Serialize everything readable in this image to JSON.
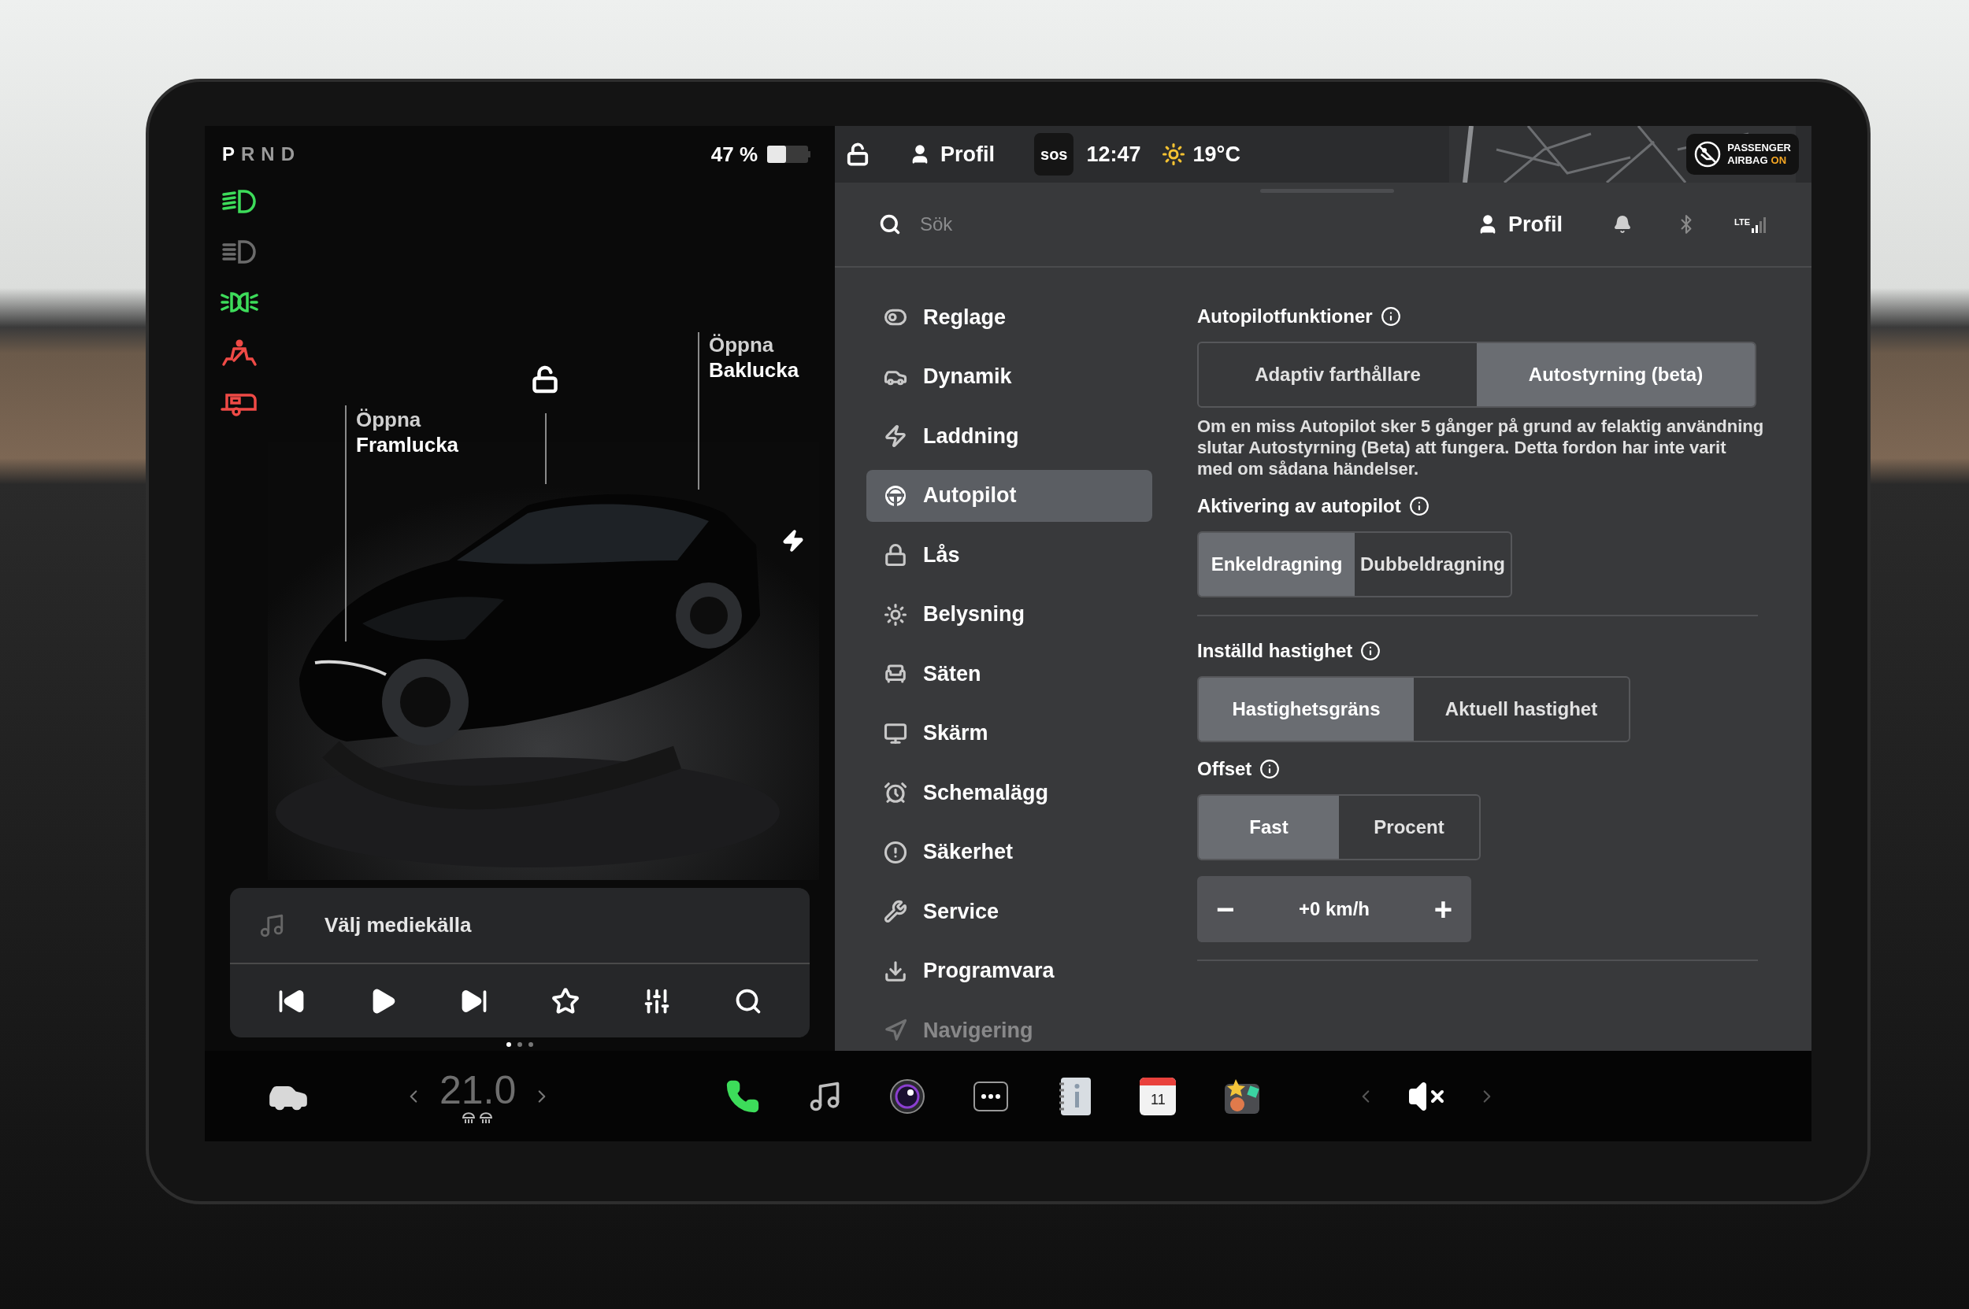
{
  "left_panel": {
    "gears": [
      {
        "label": "P",
        "selected": true
      },
      {
        "label": "R",
        "selected": false
      },
      {
        "label": "N",
        "selected": false
      },
      {
        "label": "D",
        "selected": false
      }
    ],
    "battery": "47 %",
    "indicators": [
      {
        "kind": "headlight",
        "color": "#3ddc5a"
      },
      {
        "kind": "auto_headlight",
        "color": "#6b6b6b"
      },
      {
        "kind": "parking_lights",
        "color": "#3ddc5a"
      },
      {
        "kind": "seatbelt",
        "color": "#ef4a46"
      },
      {
        "kind": "trailer",
        "color": "#ef4a46"
      }
    ],
    "car_labels": [
      {
        "action": "Öppna",
        "target": "Framlucka"
      },
      {
        "action": "Öppna",
        "target": "Baklucka"
      }
    ],
    "media": {
      "source": "Välj mediekälla"
    },
    "pages": [
      {
        "selected": true
      },
      {
        "selected": false
      },
      {
        "selected": false
      }
    ]
  },
  "status_bar": {
    "profile": "Profil",
    "sos": "sos",
    "time": "12:47",
    "temperature": "19°C",
    "airbag": {
      "line1": "PASSENGER",
      "line2": "AIRBAG",
      "state": "ON"
    }
  },
  "settings": {
    "search_placeholder": "Sök",
    "profile": "Profil",
    "network": "LTE",
    "menu": [
      {
        "label": "Reglage",
        "kind": "toggle",
        "selected": false
      },
      {
        "label": "Dynamik",
        "kind": "car",
        "selected": false
      },
      {
        "label": "Laddning",
        "kind": "bolt",
        "selected": false
      },
      {
        "label": "Autopilot",
        "kind": "wheel",
        "selected": true
      },
      {
        "label": "Lås",
        "kind": "lock",
        "selected": false
      },
      {
        "label": "Belysning",
        "kind": "light",
        "selected": false
      },
      {
        "label": "Säten",
        "kind": "seat",
        "selected": false
      },
      {
        "label": "Skärm",
        "kind": "screen",
        "selected": false
      },
      {
        "label": "Schemalägg",
        "kind": "alarm",
        "selected": false
      },
      {
        "label": "Säkerhet",
        "kind": "alert",
        "selected": false
      },
      {
        "label": "Service",
        "kind": "wrench",
        "selected": false
      },
      {
        "label": "Programvara",
        "kind": "download",
        "selected": false
      },
      {
        "label": "Navigering",
        "kind": "navigation",
        "selected": false
      }
    ],
    "sections": [
      {
        "title": "Autopilotfunktioner",
        "options": [
          {
            "label": "Adaptiv farthållare",
            "selected": false
          },
          {
            "label": "Autostyrning (beta)",
            "selected": true
          }
        ],
        "note": "Om en miss Autopilot sker 5 gånger på grund av felaktig användning slutar Autostyrning (Beta) att fungera. Detta fordon har inte varit med om sådana händelser."
      },
      {
        "title": "Aktivering av autopilot",
        "options": [
          {
            "label": "Enkeldragning",
            "selected": true
          },
          {
            "label": "Dubbeldragning",
            "selected": false
          }
        ],
        "divider": true
      },
      {
        "title": "Inställd hastighet",
        "options": [
          {
            "label": "Hastighetsgräns",
            "selected": true
          },
          {
            "label": "Aktuell hastighet",
            "selected": false
          }
        ]
      },
      {
        "title": "Offset",
        "options": [
          {
            "label": "Fast",
            "selected": true
          },
          {
            "label": "Procent",
            "selected": false
          }
        ],
        "stepper": {
          "minus": "−",
          "value": "+0 km/h",
          "plus": "+"
        },
        "divider": true
      }
    ]
  },
  "taskbar": {
    "temperature": "21.0",
    "calendar_day": "11"
  }
}
